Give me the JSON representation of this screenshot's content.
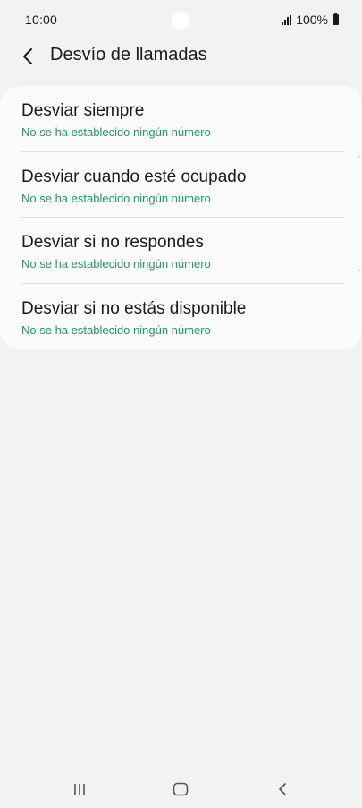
{
  "status_bar": {
    "time": "10:00",
    "battery_label": "100%"
  },
  "header": {
    "title": "Desvío de llamadas"
  },
  "settings": {
    "items": [
      {
        "title": "Desviar siempre",
        "subtitle": "No se ha establecido ningún número"
      },
      {
        "title": "Desviar cuando esté ocupado",
        "subtitle": "No se ha establecido ningún número"
      },
      {
        "title": "Desviar si no respondes",
        "subtitle": "No se ha establecido ningún número"
      },
      {
        "title": "Desviar si no estás disponible",
        "subtitle": "No se ha establecido ningún número"
      }
    ]
  },
  "colors": {
    "background": "#f2f2f2",
    "card": "#fbfbfb",
    "accent_green": "#1c9c5c",
    "text": "#1a1a1a"
  },
  "icons": {
    "back": "chevron-left-icon",
    "signal": "signal-icon",
    "battery": "battery-icon",
    "recents": "recents-icon",
    "home": "home-icon",
    "nav_back": "back-icon"
  }
}
